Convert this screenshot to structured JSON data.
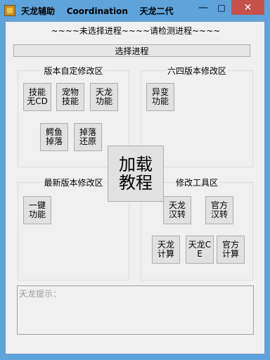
{
  "window": {
    "title": "天龙辅助    Coordination    天龙二代",
    "minimize_glyph": "—",
    "maximize_glyph": "□",
    "close_glyph": "✕"
  },
  "status": {
    "text": "~~~~未选择进程~~~~请检测进程~~~~"
  },
  "select_process_label": "选择进程",
  "groups": {
    "custom": {
      "title": "版本自定修改区",
      "buttons": [
        "技能无CD",
        "宠物技能",
        "天龙功能",
        "鳄鱼掉落",
        "掉落还原"
      ]
    },
    "v64": {
      "title": "六四版本修改区",
      "buttons": [
        "异变功能"
      ]
    },
    "latest": {
      "title": "最新版本修改区",
      "buttons": [
        "一键功能"
      ]
    },
    "tools": {
      "title": "修改工具区",
      "buttons": [
        "天龙汉转",
        "官方汉转",
        "天龙计算",
        "天龙CE",
        "官方计算"
      ]
    }
  },
  "tutorial_label": "加载教程",
  "hint_label": "天龙提示："
}
